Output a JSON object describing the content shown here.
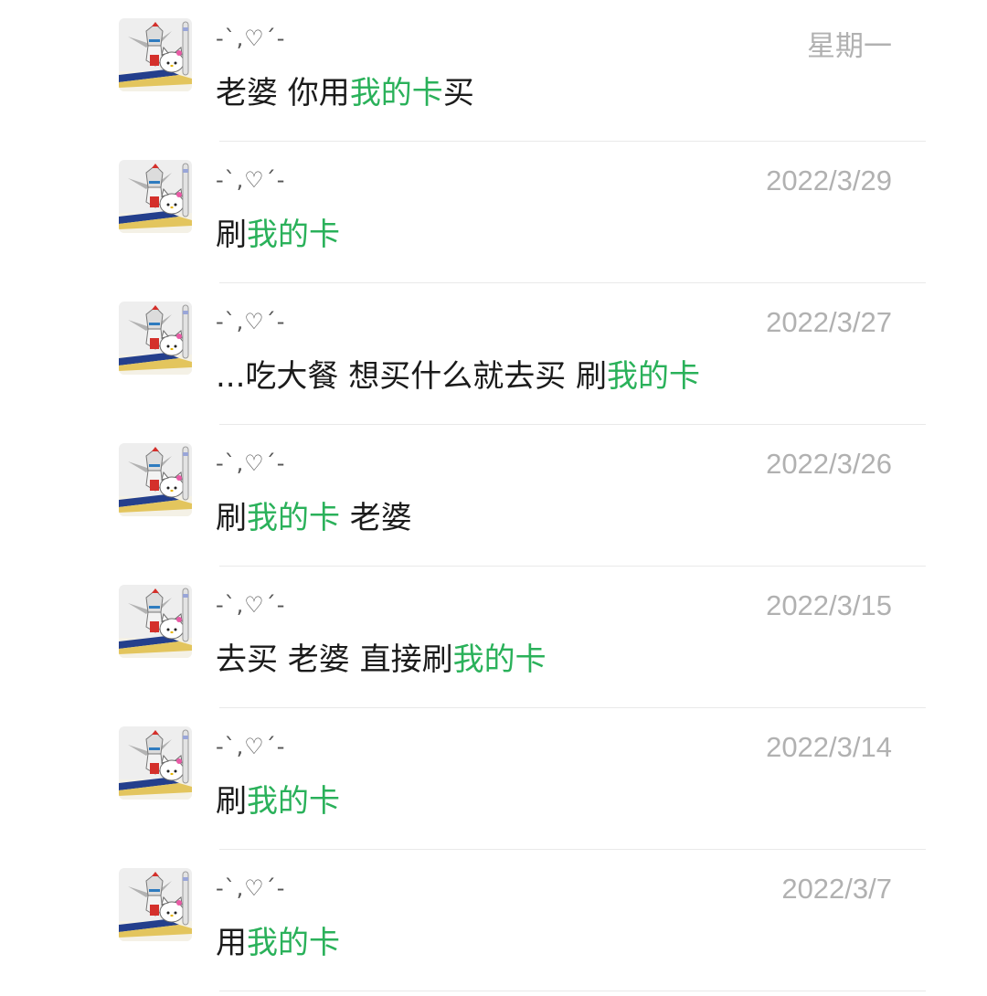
{
  "colors": {
    "highlight": "#2ab15a",
    "text": "#1b1b1b",
    "date": "#b1b1b1",
    "divider": "#e9e9e9"
  },
  "results": [
    {
      "avatar_icon": "gundam-hellokitty-avatar-icon",
      "name": "-ˋ,♡ˊ-",
      "date": "星期一",
      "before": "老婆 你用",
      "highlight": "我的卡",
      "after": "买"
    },
    {
      "avatar_icon": "gundam-hellokitty-avatar-icon",
      "name": "-ˋ,♡ˊ-",
      "date": "2022/3/29",
      "before": "刷",
      "highlight": "我的卡",
      "after": ""
    },
    {
      "avatar_icon": "gundam-hellokitty-avatar-icon",
      "name": "-ˋ,♡ˊ-",
      "date": "2022/3/27",
      "before": "...吃大餐  想买什么就去买  刷",
      "highlight": "我的卡",
      "after": ""
    },
    {
      "avatar_icon": "gundam-hellokitty-avatar-icon",
      "name": "-ˋ,♡ˊ-",
      "date": "2022/3/26",
      "before": "刷",
      "highlight": "我的卡",
      "after": "  老婆"
    },
    {
      "avatar_icon": "gundam-hellokitty-avatar-icon",
      "name": "-ˋ,♡ˊ-",
      "date": "2022/3/15",
      "before": "去买 老婆  直接刷",
      "highlight": "我的卡",
      "after": ""
    },
    {
      "avatar_icon": "gundam-hellokitty-avatar-icon",
      "name": "-ˋ,♡ˊ-",
      "date": "2022/3/14",
      "before": "刷",
      "highlight": "我的卡",
      "after": ""
    },
    {
      "avatar_icon": "gundam-hellokitty-avatar-icon",
      "name": "-ˋ,♡ˊ-",
      "date": "2022/3/7",
      "before": "用",
      "highlight": "我的卡",
      "after": ""
    }
  ]
}
